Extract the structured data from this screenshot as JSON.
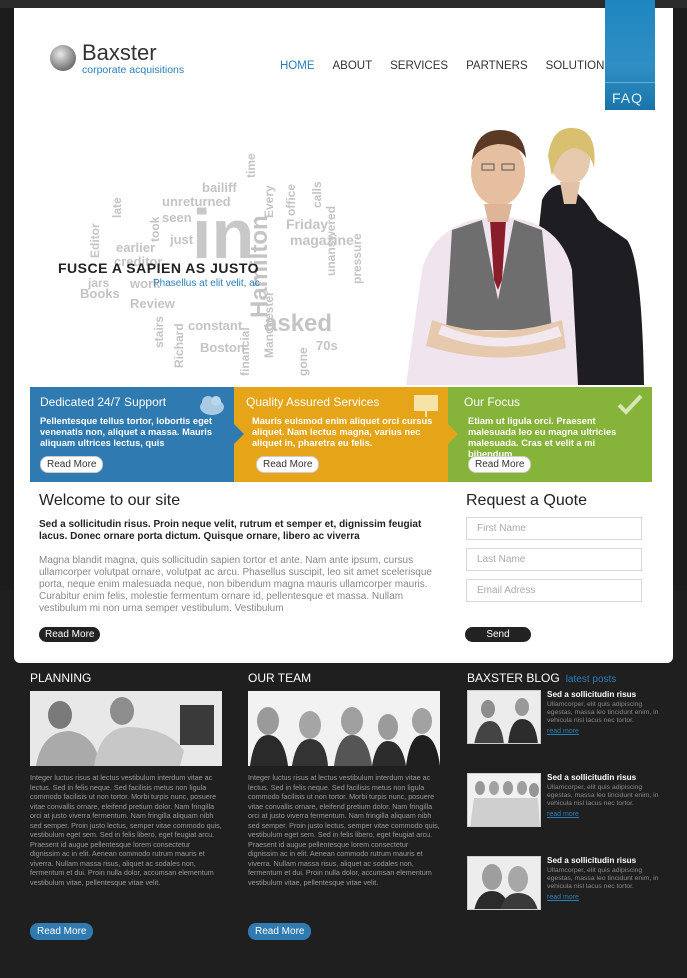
{
  "brand": {
    "name": "Baxster",
    "tagline": "corporate acquisitions"
  },
  "nav": [
    "HOME",
    "ABOUT",
    "SERVICES",
    "PARTNERS",
    "SOLUTION"
  ],
  "faq_label": "FAQ",
  "hero": {
    "title": "FUSCE A SAPIEN AS JUSTO",
    "subtitle": "Phasellus at elit velit, ac",
    "words": [
      "bailiff",
      "time",
      "unreturned",
      "office",
      "calls",
      "late",
      "took",
      "seen",
      "Every",
      "Friday",
      "Editor",
      "earlier",
      "just",
      "in",
      "magazine",
      "creditor",
      "Hamilton",
      "Manchester",
      "jars",
      "work",
      "Review",
      "Books",
      "unanswered",
      "pressure",
      "stairs",
      "Richard",
      "gone",
      "financial",
      "constant",
      "asked",
      "Boston",
      "70s"
    ]
  },
  "features": [
    {
      "title": "Dedicated 24/7 Support",
      "text": "Pellentesque tellus tortor, lobortis eget venenatis non, aliquet a massa. Mauris aliquam ultrices lectus, quis",
      "button": "Read More",
      "icon": "cloud-icon"
    },
    {
      "title": "Quality Assured Services",
      "text": "Mauris euismod enim aliquet orci cursus aliquet. Nam lectus magna, varius nec aliquet in, pharetra eu felis.",
      "button": "Read More",
      "icon": "presentation-board-icon"
    },
    {
      "title": "Our Focus",
      "text": "Etiam ut ligula orci. Praesent malesuada leo eu magna ultricies malesuada. Cras et velit a mi bibendum",
      "button": "Read More",
      "icon": "checkmark-icon"
    }
  ],
  "welcome": {
    "title": "Welcome to our site",
    "lead": "Sed a sollicitudin risus. Proin neque velit, rutrum et semper et, dignissim feugiat lacus. Donec ornare porta dictum. Quisque ornare, libero ac viverra",
    "body": "Magna blandit magna, quis sollicitudin sapien tortor et ante. Nam ante ipsum, cursus ullamcorper volutpat ornare, volutpat ac arcu. Phasellus suscipit, leo sit amet scelerisque porta, neque enim malesuada neque, non bibendum magna mauris ullamcorper mauris. Curabitur enim felis, molestie fermentum ornare id, pellentesque et massa. Nullam vestibulum mi non urna semper vestibulum. Vestibulum",
    "button": "Read More"
  },
  "quote": {
    "title": "Request a Quote",
    "first_name": "First Name",
    "last_name": "Last Name",
    "email": "Email Adress",
    "button": "Send"
  },
  "planning": {
    "title": "PLANNING",
    "text": "Integer luctus risus at lectus vestibulum interdum vitae ac lectus. Sed in felis neque. Sed facilisis metus non ligula commodo facilisis ut non tortor. Morbi turpis nunc, posuere vitae convallis ornare, eleifend pretium dolor. Nam fringilla orci at justo viverra fermentum. Nam fringilla aliquam nibh sed semper. Proin justo lectus, semper vitae commodo quis, vestibulum eget sem. Sed in felis libero, eget feugiat arcu. Praesent id augue pellentesque lorem consectetur dignissim ac in elit. Aenean commodo rutrum mauris et viverra. Nullam massa risus, aliquet ac sodales non, fermentum et dui. Proin nulla dolor, accumsan elementum vestibulum vitae, pellentesque vitae velit.",
    "button": "Read More"
  },
  "team": {
    "title": "OUR TEAM",
    "text": "Integer luctus risus at lectus vestibulum interdum vitae ac lectus. Sed in felis neque. Sed facilisis metus non ligula commodo facilisis ut non tortor. Morbi turpis nunc, posuere vitae convallis ornare, eleifend pretium dolor. Nam fringilla orci at justo viverra fermentum. Nam fringilla aliquam nibh sed semper. Proin justo lectus, semper vitae commodo quis, vestibulum eget sem. Sed in felis libero, eget feugiat arcu. Praesent id augue pellentesque lorem consectetur dignissim ac in elit. Aenean commodo rutrum mauris et viverra. Nullam massa risus, aliquet ac sodales non, fermentum et dui. Proin nulla dolor, accumsan elementum vestibulum vitae, pellentesque vitae velit.",
    "button": "Read More"
  },
  "blog": {
    "title": "BAXSTER BLOG",
    "subtitle": "latest posts",
    "posts": [
      {
        "title": "Sed a sollicitudin risus",
        "text": "Ullamcorper, elit quis adipiscing egestas, massa leo tincidunt enim, in vehicula nisl lacus nec tortor.",
        "link": "read more"
      },
      {
        "title": "Sed a sollicitudin risus",
        "text": "Ullamcorper, elit quis adipiscing egestas, massa leo tincidunt enim, in vehicula nisl lacus nec tortor.",
        "link": "read more"
      },
      {
        "title": "Sed a sollicitudin risus",
        "text": "Ullamcorper, elit quis adipiscing egestas, massa leo tincidunt enim, in vehicula nisl lacus nec tortor.",
        "link": "read more"
      }
    ]
  },
  "colors": {
    "accent": "#2a7fb8",
    "support": "#2f7ab0",
    "quality": "#e6a519",
    "focus": "#86b33a",
    "footer": "#1c1c1c"
  }
}
